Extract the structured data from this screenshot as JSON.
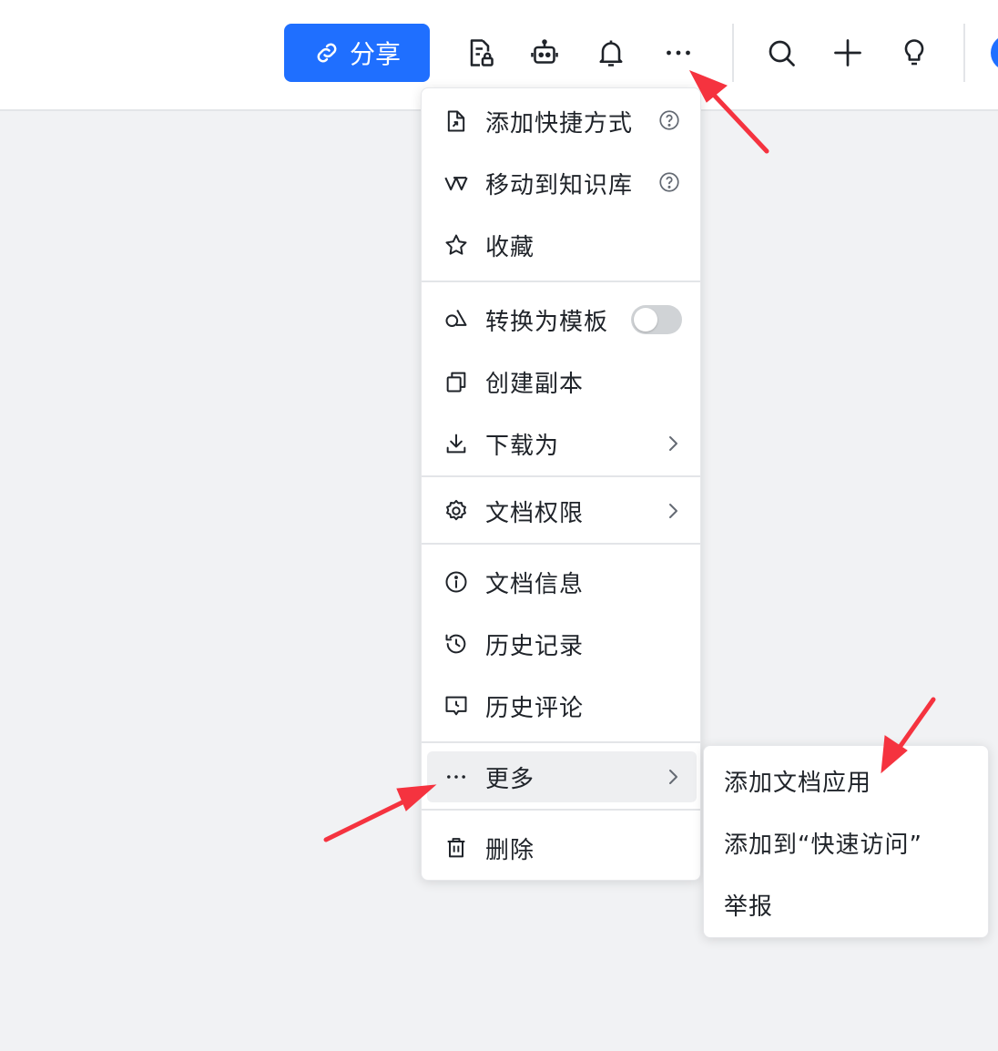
{
  "toolbar": {
    "share_label": "分享",
    "icons": [
      "doc-lock-icon",
      "robot-icon",
      "bell-icon",
      "more-icon",
      "search-icon",
      "plus-icon",
      "lightbulb-icon"
    ]
  },
  "menu": {
    "items": [
      {
        "label": "添加快捷方式",
        "icon": "shortcut-icon",
        "help": true
      },
      {
        "label": "移动到知识库",
        "icon": "wiki-icon",
        "help": true
      },
      {
        "label": "收藏",
        "icon": "star-icon"
      },
      {
        "label": "转换为模板",
        "icon": "template-icon",
        "toggle": "off"
      },
      {
        "label": "创建副本",
        "icon": "copy-icon"
      },
      {
        "label": "下载为",
        "icon": "download-icon",
        "submenu": true
      },
      {
        "label": "文档权限",
        "icon": "gear-icon",
        "submenu": true
      },
      {
        "label": "文档信息",
        "icon": "info-icon"
      },
      {
        "label": "历史记录",
        "icon": "history-icon"
      },
      {
        "label": "历史评论",
        "icon": "comment-history-icon"
      },
      {
        "label": "更多",
        "icon": "more-icon",
        "submenu": true,
        "highlighted": true
      },
      {
        "label": "删除",
        "icon": "trash-icon"
      }
    ]
  },
  "submenu": {
    "items": [
      {
        "label": "添加文档应用"
      },
      {
        "label": "添加到“快速访问”"
      },
      {
        "label": "举报"
      }
    ]
  },
  "colors": {
    "accent": "#1f6fff",
    "background": "#f1f2f4",
    "arrow": "#f5333f"
  }
}
